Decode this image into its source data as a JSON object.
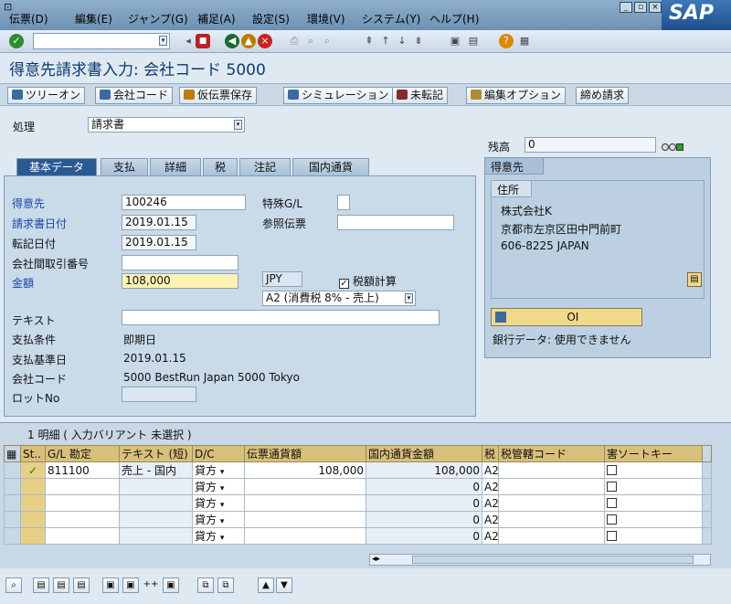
{
  "menu": [
    "伝票(D)",
    "編集(E)",
    "ジャンプ(G)",
    "補足(A)",
    "設定(S)",
    "環境(V)",
    "システム(Y)",
    "ヘルプ(H)"
  ],
  "brand": "SAP",
  "title": "得意先請求書入力: 会社コード 5000",
  "app_toolbar": [
    "ツリーオン",
    "会社コード",
    "仮伝票保存",
    "シミュレーション",
    "未転記",
    "編集オプション",
    "締め請求"
  ],
  "process": {
    "label": "処理",
    "value": "請求書"
  },
  "balance": {
    "label": "残高",
    "value": "0"
  },
  "tabs": [
    "基本データ",
    "支払",
    "詳細",
    "税",
    "注記",
    "国内通貨"
  ],
  "form": {
    "customer": {
      "label": "得意先",
      "value": "100246"
    },
    "invoice_date": {
      "label": "請求書日付",
      "value": "2019.01.15"
    },
    "posting_date": {
      "label": "転記日付",
      "value": "2019.01.15"
    },
    "intercompany": {
      "label": "会社間取引番号",
      "value": ""
    },
    "amount": {
      "label": "金額",
      "value": "108,000"
    },
    "currency": "JPY",
    "calc_tax": "税額計算",
    "tax_code": "A2 (消費税 8% - 売上)",
    "special_gl": {
      "label": "特殊G/L",
      "value": ""
    },
    "reference": {
      "label": "参照伝票",
      "value": ""
    },
    "text": {
      "label": "テキスト",
      "value": ""
    },
    "payment_terms": {
      "label": "支払条件",
      "value": "即期日"
    },
    "baseline_date": {
      "label": "支払基準日",
      "value": "2019.01.15"
    },
    "company_code": {
      "label": "会社コード",
      "value": "5000 BestRun Japan 5000 Tokyo"
    },
    "lot_no": {
      "label": "ロットNo",
      "value": ""
    }
  },
  "customer_box": {
    "title": "得意先",
    "address_tab": "住所",
    "lines": [
      "株式会社K",
      "京都市左京区田中門前町",
      "606-8225 JAPAN"
    ],
    "oi_button": "OI",
    "bank_data": "銀行データ: 使用できません"
  },
  "items": {
    "header": "1 明細 ( 入力バリアント 未選択 )",
    "columns": [
      "St..",
      "G/L 勘定",
      "テキスト (短)",
      "D/C",
      "伝票通貨額",
      "国内通貨金額",
      "税",
      "税管轄コード",
      "害ソートキー"
    ],
    "rows": [
      {
        "gl": "811100",
        "text": "売上 - 国内",
        "dc": "貸方",
        "doc_amt": "108,000",
        "loc_amt": "108,000",
        "tax": "A2"
      },
      {
        "gl": "",
        "text": "",
        "dc": "貸方",
        "doc_amt": "",
        "loc_amt": "0",
        "tax": "A2"
      },
      {
        "gl": "",
        "text": "",
        "dc": "貸方",
        "doc_amt": "",
        "loc_amt": "0",
        "tax": "A2"
      },
      {
        "gl": "",
        "text": "",
        "dc": "貸方",
        "doc_amt": "",
        "loc_amt": "0",
        "tax": "A2"
      },
      {
        "gl": "",
        "text": "",
        "dc": "貸方",
        "doc_amt": "",
        "loc_amt": "0",
        "tax": "A2"
      }
    ]
  }
}
